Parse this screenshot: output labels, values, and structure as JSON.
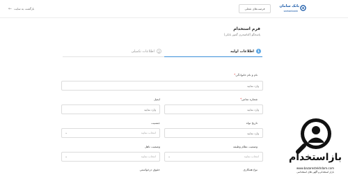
{
  "header": {
    "back_link": "بازگشت به سایت",
    "jobs_button": "فرصت‌های شغلی",
    "brand_fa": "بانک سامان",
    "brand_en": "samanbank",
    "brand_color": "#0a4ea2"
  },
  "form": {
    "title": "فرم استخدام",
    "subtitle": "پاسخگو (کتاصحری گمور بانکی)"
  },
  "tabs": [
    {
      "number": "1",
      "label": "اطلاعات اولیه",
      "active": true
    },
    {
      "number": "2",
      "label": "اطلاعات تکمیلی",
      "active": false
    }
  ],
  "fields": {
    "full_name": {
      "label": "نام و نام خانوادگی",
      "required_mark": "*",
      "placeholder": "وارد نمایید"
    },
    "phone": {
      "label": "شماره تماس",
      "required_mark": "*",
      "placeholder": "وارد نمایید"
    },
    "email": {
      "label": "ایمیل",
      "placeholder": "وارد نمایید"
    },
    "birth_date": {
      "label": "تاریخ تولد",
      "placeholder": "وارد نمایید"
    },
    "gender": {
      "label": "جنسیت",
      "placeholder": "انتخاب نمایید"
    },
    "military": {
      "label": "وضعیت نظام وظیفه",
      "placeholder": "انتخاب نمایید"
    },
    "marital": {
      "label": "وضعیت تاهل",
      "placeholder": "انتخاب نمایید"
    },
    "cooperation": {
      "label": "نوع همکاری"
    },
    "salary": {
      "label": "حقوق درخواستی"
    }
  },
  "watermark": {
    "brand": "بازاستخدام",
    "site": "www.bazarestekhdam.com",
    "tagline": "بازار استخدام و آگهی های استخدامی"
  },
  "colors": {
    "accent": "#3b8fd9",
    "required": "#e53935",
    "watermark": "#111111"
  }
}
